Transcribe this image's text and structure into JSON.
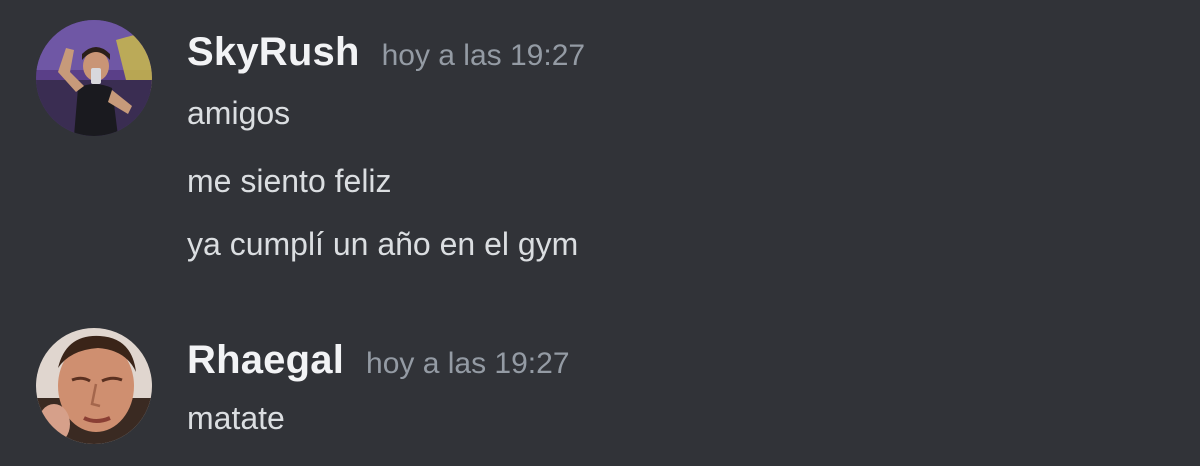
{
  "colors": {
    "background": "#313338",
    "username": "#f2f3f5",
    "timestamp": "#949ba4",
    "message_text": "#dbdee1"
  },
  "messages": [
    {
      "username": "SkyRush",
      "timestamp": "hoy a las 19:27",
      "lines": [
        "amigos",
        "me siento feliz",
        "ya cumplí un año en el gym"
      ]
    },
    {
      "username": "Rhaegal",
      "timestamp": "hoy a las 19:27",
      "lines": [
        "matate"
      ]
    }
  ]
}
